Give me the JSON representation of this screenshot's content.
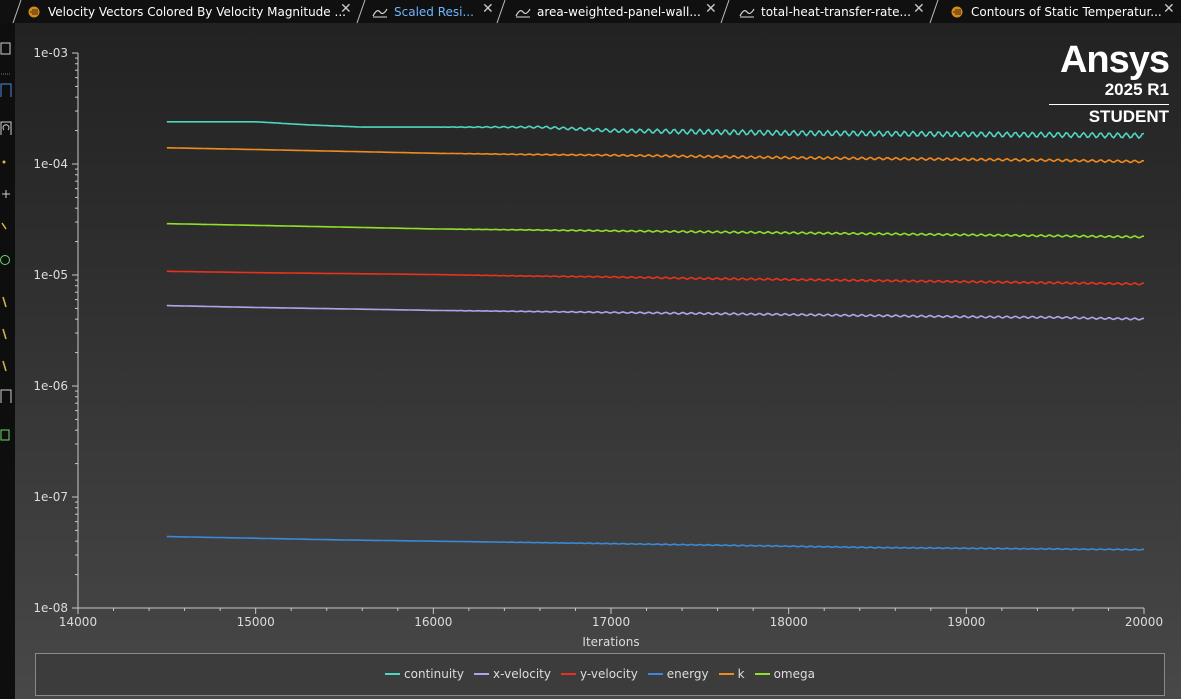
{
  "tabs": [
    {
      "label": "Velocity Vectors Colored By Velocity Magnitude ...",
      "icon": "fluent-graphics-icon",
      "active": false
    },
    {
      "label": "Scaled Resi...",
      "icon": "residuals-plot-icon",
      "active": true
    },
    {
      "label": "area-weighted-panel-wall...",
      "icon": "report-plot-icon",
      "active": false
    },
    {
      "label": "total-heat-transfer-rate...",
      "icon": "report-plot-icon",
      "active": false
    },
    {
      "label": "Contours of Static Temperatur...",
      "icon": "fluent-graphics-icon",
      "active": false
    }
  ],
  "close_glyph": "✕",
  "watermark": {
    "name": "Ansys",
    "version": "2025 R1",
    "edition": "STUDENT"
  },
  "colors": {
    "continuity": "#4fd6c0",
    "x-velocity": "#b0a4e8",
    "y-velocity": "#e8321e",
    "energy": "#3a88d6",
    "k": "#f08a1c",
    "omega": "#8ee02a"
  },
  "chart_data": {
    "type": "line",
    "title": "",
    "xlabel": "Iterations",
    "ylabel": "",
    "yscale": "log",
    "xlim": [
      14000,
      20000
    ],
    "ylim": [
      1e-08,
      0.001
    ],
    "x_ticks": [
      14000,
      15000,
      16000,
      17000,
      18000,
      19000,
      20000
    ],
    "x_tick_labels": [
      "14000",
      "15000",
      "16000",
      "17000",
      "18000",
      "19000",
      "20000"
    ],
    "y_ticks": [
      0.001,
      0.0001,
      1e-05,
      1e-06,
      1e-07,
      1e-08
    ],
    "y_tick_labels": [
      "1e-03",
      "1e-04",
      "1e-05",
      "1e-06",
      "1e-07",
      "1e-08"
    ],
    "grid": false,
    "legend_position": "bottom",
    "series": [
      {
        "name": "continuity",
        "x": [
          14500,
          15000,
          15300,
          15600,
          16000,
          16300,
          16600,
          17000,
          17500,
          18000,
          18500,
          19000,
          19500,
          20000
        ],
        "values": [
          0.00024,
          0.00024,
          0.000225,
          0.000215,
          0.000215,
          0.000215,
          0.000215,
          0.0002,
          0.000195,
          0.00019,
          0.000188,
          0.000185,
          0.000183,
          0.00018
        ]
      },
      {
        "name": "x-velocity",
        "x": [
          14500,
          15000,
          15500,
          16000,
          16500,
          17000,
          17500,
          18000,
          18500,
          19000,
          19500,
          20000
        ],
        "values": [
          5.3e-06,
          5.1e-06,
          4.95e-06,
          4.8e-06,
          4.7e-06,
          4.6e-06,
          4.5e-06,
          4.4e-06,
          4.3e-06,
          4.2e-06,
          4.15e-06,
          4e-06
        ]
      },
      {
        "name": "y-velocity",
        "x": [
          14500,
          15000,
          15500,
          16000,
          16500,
          17000,
          17500,
          18000,
          18500,
          19000,
          19500,
          20000
        ],
        "values": [
          1.08e-05,
          1.05e-05,
          1.03e-05,
          1.01e-05,
          9.8e-06,
          9.6e-06,
          9.3e-06,
          9.1e-06,
          8.9e-06,
          8.7e-06,
          8.5e-06,
          8.3e-06
        ]
      },
      {
        "name": "energy",
        "x": [
          14500,
          15000,
          15500,
          16000,
          16500,
          17000,
          17500,
          18000,
          18500,
          19000,
          19500,
          20000
        ],
        "values": [
          4.4e-08,
          4.25e-08,
          4.1e-08,
          4e-08,
          3.9e-08,
          3.8e-08,
          3.7e-08,
          3.6e-08,
          3.5e-08,
          3.45e-08,
          3.4e-08,
          3.35e-08
        ]
      },
      {
        "name": "k",
        "x": [
          14500,
          15000,
          15500,
          16000,
          16500,
          17000,
          17500,
          18000,
          18500,
          19000,
          19500,
          20000
        ],
        "values": [
          0.00014,
          0.000135,
          0.00013,
          0.000125,
          0.000122,
          0.00012,
          0.000117,
          0.000114,
          0.000112,
          0.00011,
          0.000108,
          0.000105
        ]
      },
      {
        "name": "omega",
        "x": [
          14500,
          15000,
          15500,
          16000,
          16500,
          17000,
          17500,
          18000,
          18500,
          19000,
          19500,
          20000
        ],
        "values": [
          2.9e-05,
          2.8e-05,
          2.7e-05,
          2.6e-05,
          2.55e-05,
          2.5e-05,
          2.45e-05,
          2.4e-05,
          2.35e-05,
          2.3e-05,
          2.25e-05,
          2.2e-05
        ]
      }
    ]
  }
}
